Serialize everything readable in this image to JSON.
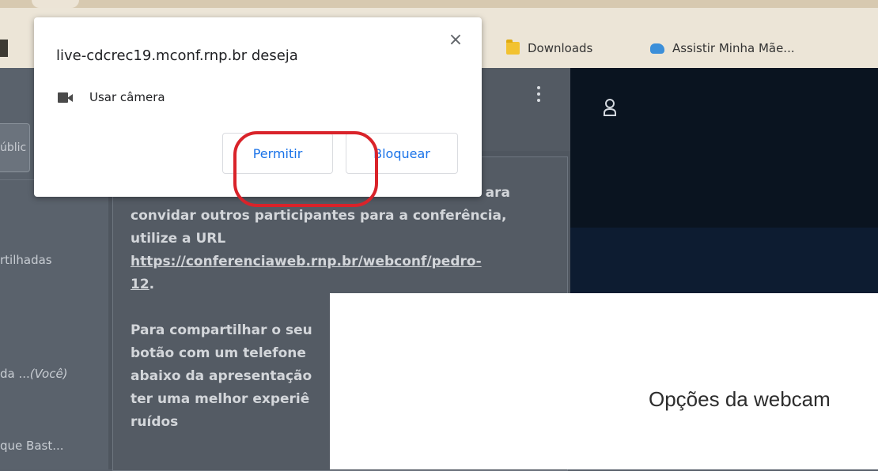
{
  "browser": {
    "bookmarks": [
      {
        "label": "Downloads",
        "icon": "folder-icon"
      },
      {
        "label": "Assistir Minha Mãe...",
        "icon": "cloud-icon"
      }
    ]
  },
  "permission_popup": {
    "title": "live-cdcrec19.mconf.rnp.br deseja",
    "close_label": "×",
    "request_label": "Usar câmera",
    "request_icon": "video-camera-icon",
    "allow_label": "Permitir",
    "block_label": "Bloquear",
    "highlight_color": "#d9232a",
    "button_text_color": "#1a73e8"
  },
  "left_sidebar": {
    "tab_fragment": "úblic",
    "items": [
      {
        "label": "rtilhadas"
      },
      {
        "label": "da ...",
        "suffix": "(Você)"
      },
      {
        "label": "que Bast..."
      }
    ]
  },
  "chat": {
    "line1_tail": "ara",
    "line2": "convidar outros participantes para a conferência,",
    "line3": "utilize a URL",
    "url_part1": "https://conferenciaweb.rnp.br/webconf/pedro-",
    "url_part2": "12",
    "url_end": ".",
    "para2_line1": "Para compartilhar o seu",
    "para2_line2": "botão com um telefone",
    "para2_line3": "abaixo da apresentação",
    "para2_line4": "ter uma melhor experiê",
    "para2_line5": "ruídos"
  },
  "webcam_modal": {
    "title": "Opções da webcam"
  }
}
